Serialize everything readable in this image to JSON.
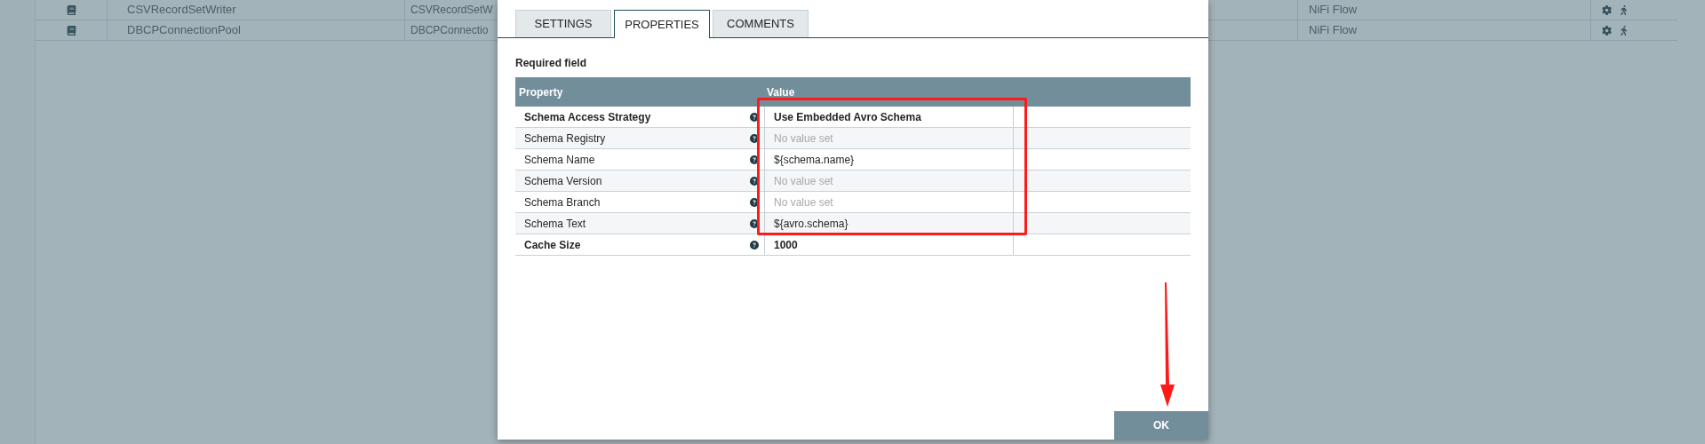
{
  "background_table": {
    "rows": [
      {
        "name": "CSVRecordSetWriter",
        "type": "CSVRecordSetW",
        "group": "NiFi Flow"
      },
      {
        "name": "DBCPConnectionPool",
        "type": "DBCPConnectio",
        "group": "NiFi Flow"
      }
    ]
  },
  "dialog": {
    "tabs": [
      {
        "label": "SETTINGS",
        "selected": false
      },
      {
        "label": "PROPERTIES",
        "selected": true
      },
      {
        "label": "COMMENTS",
        "selected": false
      }
    ],
    "note": "Required field",
    "table": {
      "columns": [
        "Property",
        "Value"
      ],
      "rows": [
        {
          "property": "Schema Access Strategy",
          "required": true,
          "value": "Use Embedded Avro Schema",
          "empty": false
        },
        {
          "property": "Schema Registry",
          "required": false,
          "value": "No value set",
          "empty": true
        },
        {
          "property": "Schema Name",
          "required": false,
          "value": "${schema.name}",
          "empty": false
        },
        {
          "property": "Schema Version",
          "required": false,
          "value": "No value set",
          "empty": true
        },
        {
          "property": "Schema Branch",
          "required": false,
          "value": "No value set",
          "empty": true
        },
        {
          "property": "Schema Text",
          "required": false,
          "value": "${avro.schema}",
          "empty": false
        },
        {
          "property": "Cache Size",
          "required": true,
          "value": "1000",
          "empty": false
        }
      ]
    },
    "ok_button": "OK"
  }
}
